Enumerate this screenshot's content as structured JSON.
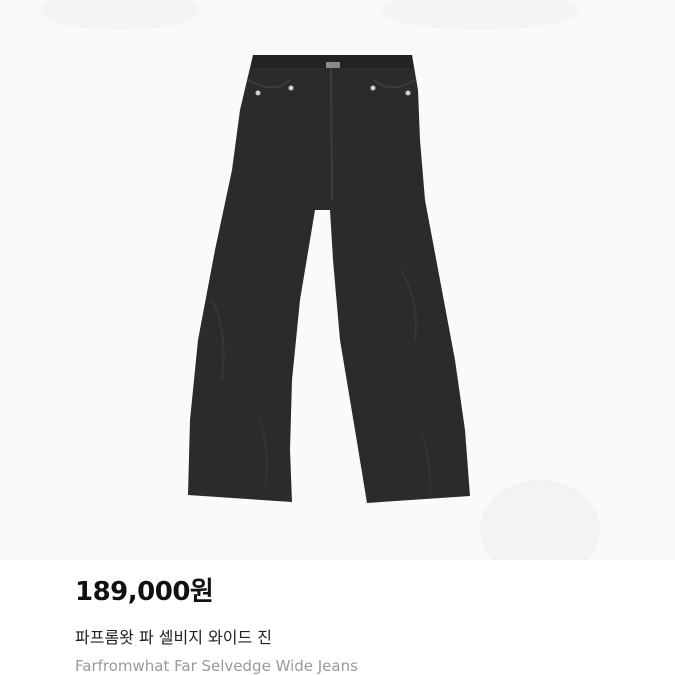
{
  "product": {
    "image_icon": "jeans-photo",
    "price": "189,000원",
    "name_ko": "파프롬왓 파 셀비지 와이드 진",
    "name_en": "Farfromwhat Far Selvedge Wide Jeans"
  },
  "colors": {
    "background": "#ffffff",
    "price_text": "#111111",
    "name_ko_text": "#222222",
    "name_en_text": "#9a9a9a",
    "denim": "#2b2b2d"
  }
}
